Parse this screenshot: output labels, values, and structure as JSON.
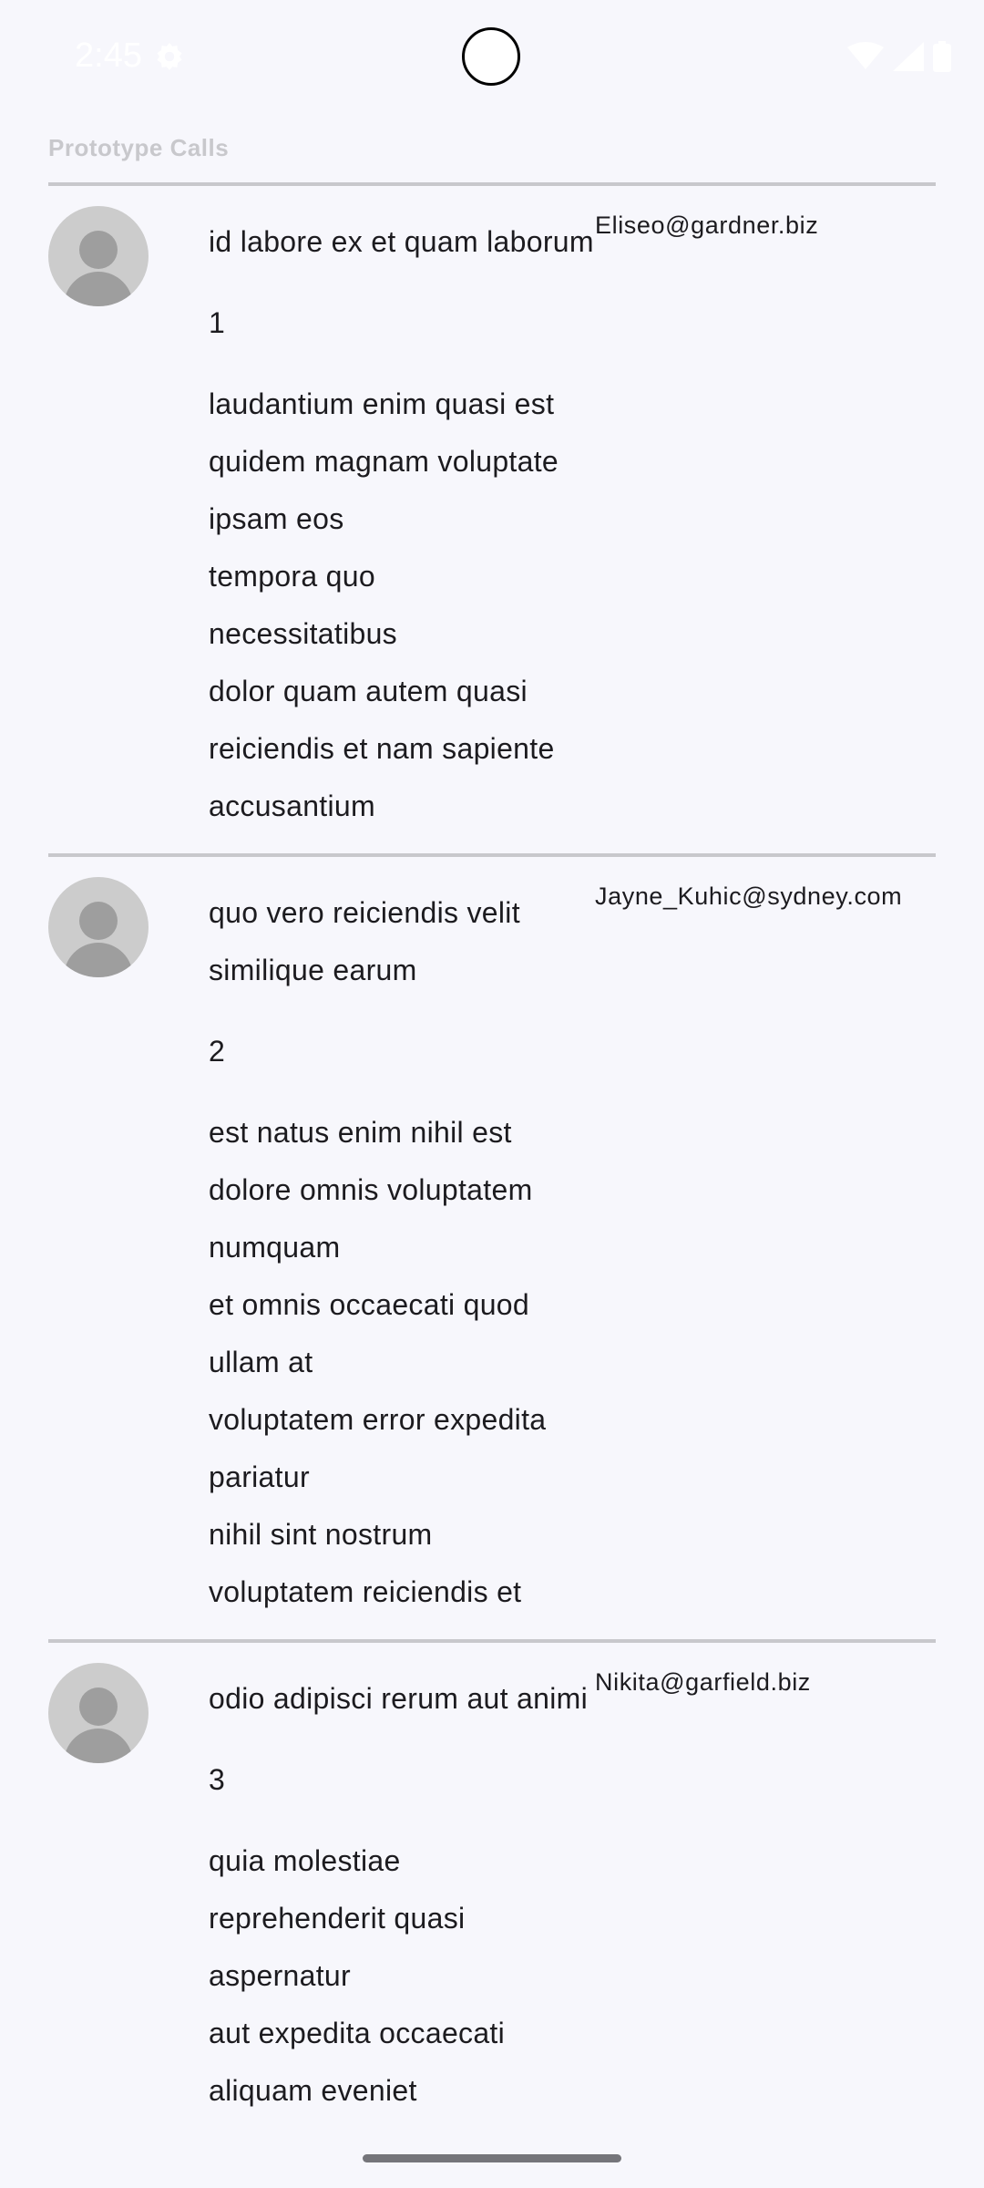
{
  "status_bar": {
    "time": "2:45"
  },
  "app": {
    "title": "Prototype Calls"
  },
  "posts": [
    {
      "title": "id labore ex et quam laborum",
      "id": "1",
      "email": "Eliseo@gardner.biz",
      "body": "laudantium enim quasi est\nquidem magnam voluptate\nipsam eos\ntempora quo\nnecessitatibus\ndolor quam autem quasi\nreiciendis et nam sapiente\naccusantium"
    },
    {
      "title": "quo vero reiciendis velit similique earum",
      "id": "2",
      "email": "Jayne_Kuhic@sydney.com",
      "body": "est natus enim nihil est\ndolore omnis voluptatem\nnumquam\net omnis occaecati quod\nullam at\nvoluptatem error expedita\npariatur\nnihil sint nostrum\nvoluptatem reiciendis et"
    },
    {
      "title": "odio adipisci rerum aut animi",
      "id": "3",
      "email": "Nikita@garfield.biz",
      "body": "quia molestiae\nreprehenderit quasi\naspernatur\naut expedita occaecati\naliquam eveniet"
    }
  ],
  "colors": {
    "background": "#f7f7fc",
    "divider": "#c8c8cc",
    "avatar_bg": "#cccccc",
    "avatar_fg": "#9e9e9e"
  },
  "icons": [
    "settings-gear-icon",
    "wifi-icon",
    "cellular-signal-icon",
    "battery-icon",
    "person-placeholder-icon"
  ]
}
